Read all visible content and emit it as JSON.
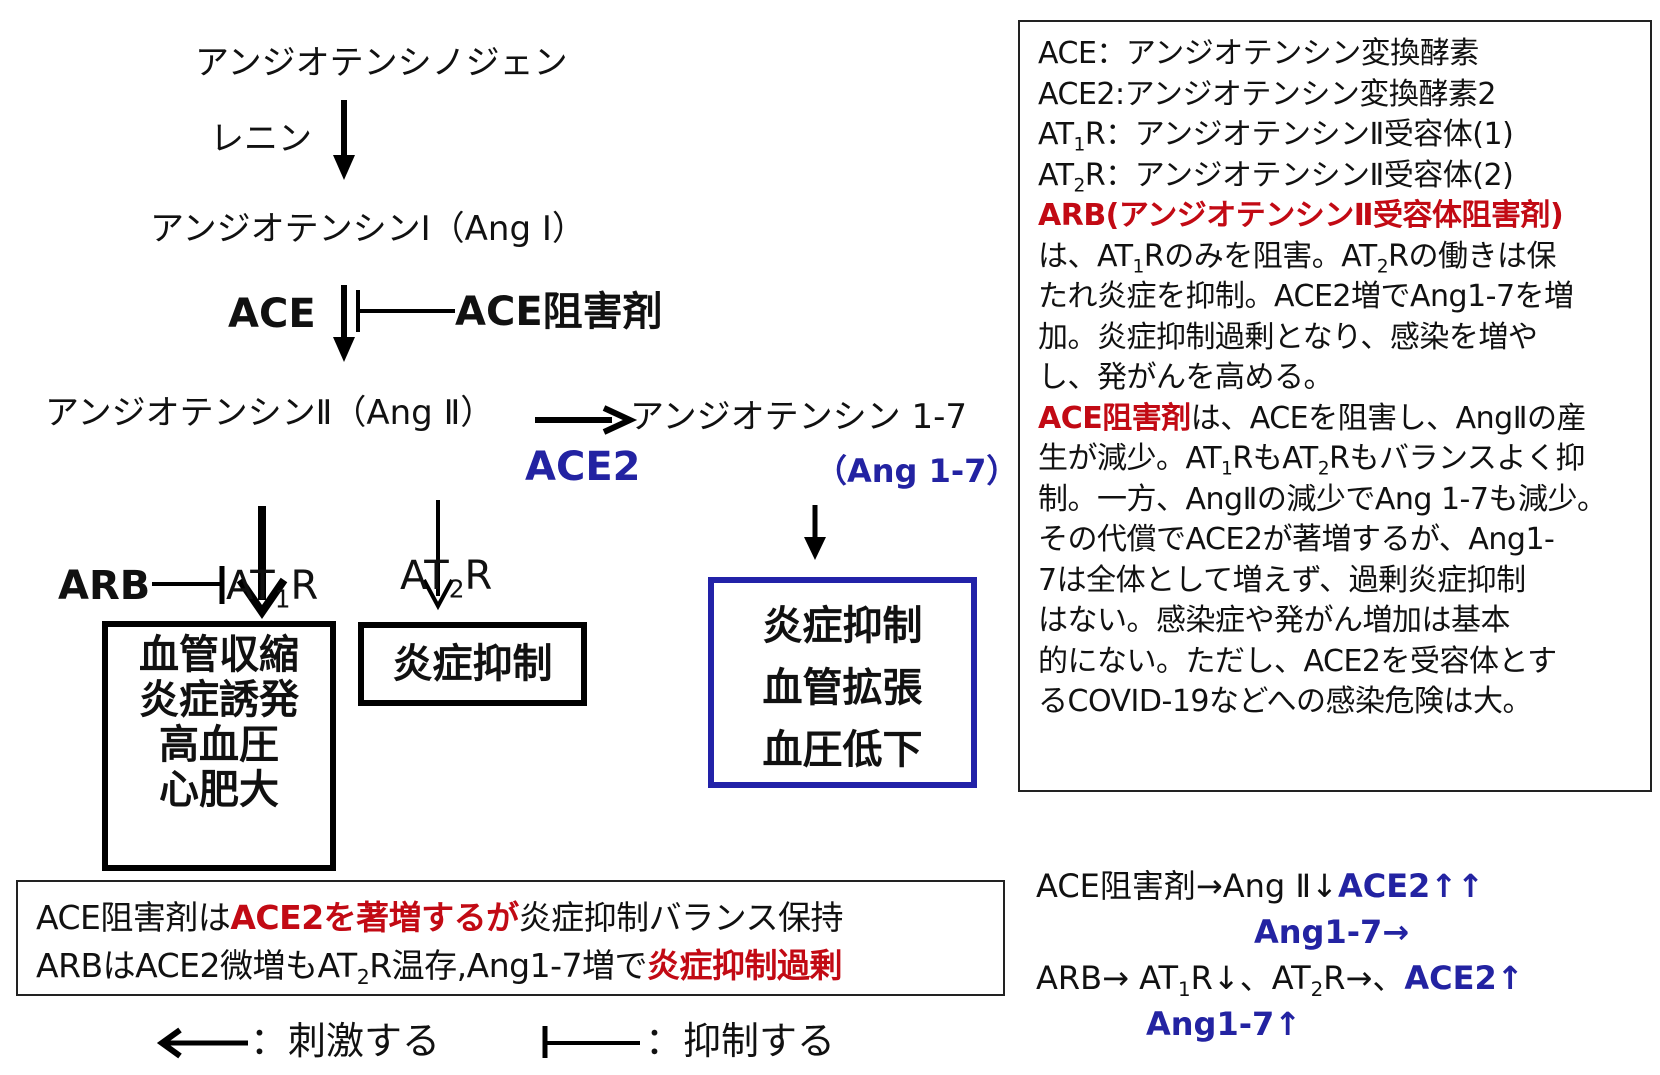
{
  "colors": {
    "blue": "#2323a2",
    "red": "#c20a14",
    "black": "#111111"
  },
  "pathway": {
    "angiotensinogen": "アンジオテンシノジェン",
    "renin": "レニン",
    "ang1": "アンジオテンシンⅠ（Ang Ⅰ）",
    "ace": "ACE",
    "ace_inhibitor": "ACE阻害剤",
    "ang2": "アンジオテンシンⅡ（Ang Ⅱ）",
    "ace2": "ACE2",
    "ang17": "アンジオテンシン 1-7",
    "ang17_abbr": "（Ang 1-7）",
    "arb": "ARB",
    "at1r": {
      "base": "AT",
      "sub": "1",
      "suffix": "R"
    },
    "at2r": {
      "base": "AT",
      "sub": "2",
      "suffix": "R"
    }
  },
  "effects": {
    "at1r": [
      "血管収縮",
      "炎症誘発",
      "高血圧",
      "心肥大"
    ],
    "at2r": [
      "炎症抑制"
    ],
    "ang17": [
      "炎症抑制",
      "血管拡張",
      "血圧低下"
    ]
  },
  "panel": {
    "def_ace": "ACE：アンジオテンシン変換酵素",
    "def_ace2": "ACE2:アンジオテンシン変換酵素2",
    "def_at1r_pre": "AT",
    "def_at1r_sub": "1",
    "def_at1r_post": "R：アンジオテンシンⅡ受容体(1)",
    "def_at2r_pre": "AT",
    "def_at2r_sub": "2",
    "def_at2r_post": "R：アンジオテンシンⅡ受容体(2)",
    "arb_heading": "ARB(アンジオテンシンⅡ受容体阻害剤)",
    "arb_l1_a": "は、AT",
    "arb_l1_s1": "1",
    "arb_l1_b": "Rのみを阻害。AT",
    "arb_l1_s2": "2",
    "arb_l1_c": "Rの働きは保",
    "arb_l2": "たれ炎症を抑制。ACE2増でAng1-7を増",
    "arb_l3": "加。炎症抑制過剰となり、感染を増や",
    "arb_l4": "し、発がんを高める。",
    "acei_heading": "ACE阻害剤",
    "acei_l1_rest": "は、ACEを阻害し、AngⅡの産",
    "acei_l2_a": "生が減少。AT",
    "acei_l2_s1": "1",
    "acei_l2_b": "RもAT",
    "acei_l2_s2": "2",
    "acei_l2_c": "Rもバランスよく抑",
    "acei_l3": "制。一方、AngⅡの減少でAng 1-7も減少。",
    "acei_l4": "その代償でACE2が著増するが、Ang1-",
    "acei_l5": "7は全体として増えず、過剰炎症抑制",
    "acei_l6": "はない。感染症や発がん増加は基本",
    "acei_l7": "的にない。ただし、ACE2を受容体とす",
    "acei_l8": "るCOVID-19などへの感染危険は大。"
  },
  "summary": {
    "l1_a": "ACE阻害剤は",
    "l1_b": "ACE2を著増するが",
    "l1_c": "炎症抑制バランス保持",
    "l2_a": "ARBはACE2微増もAT",
    "l2_sub": "2",
    "l2_b": "R温存,Ang1-7増で",
    "l2_c": "炎症抑制過剰"
  },
  "notes": {
    "l1_a": "ACE阻害剤→Ang Ⅱ↓",
    "l1_b": "ACE2↑↑",
    "l2": "Ang1-7→",
    "l3_a": "ARB→ AT",
    "l3_s1": "1",
    "l3_b": "R↓、AT",
    "l3_s2": "2",
    "l3_c": "R→、",
    "l3_d": "ACE2↑",
    "l4": "Ang1-7↑"
  },
  "legend": {
    "stimulate": "：刺激する",
    "inhibit": "：抑制する"
  }
}
